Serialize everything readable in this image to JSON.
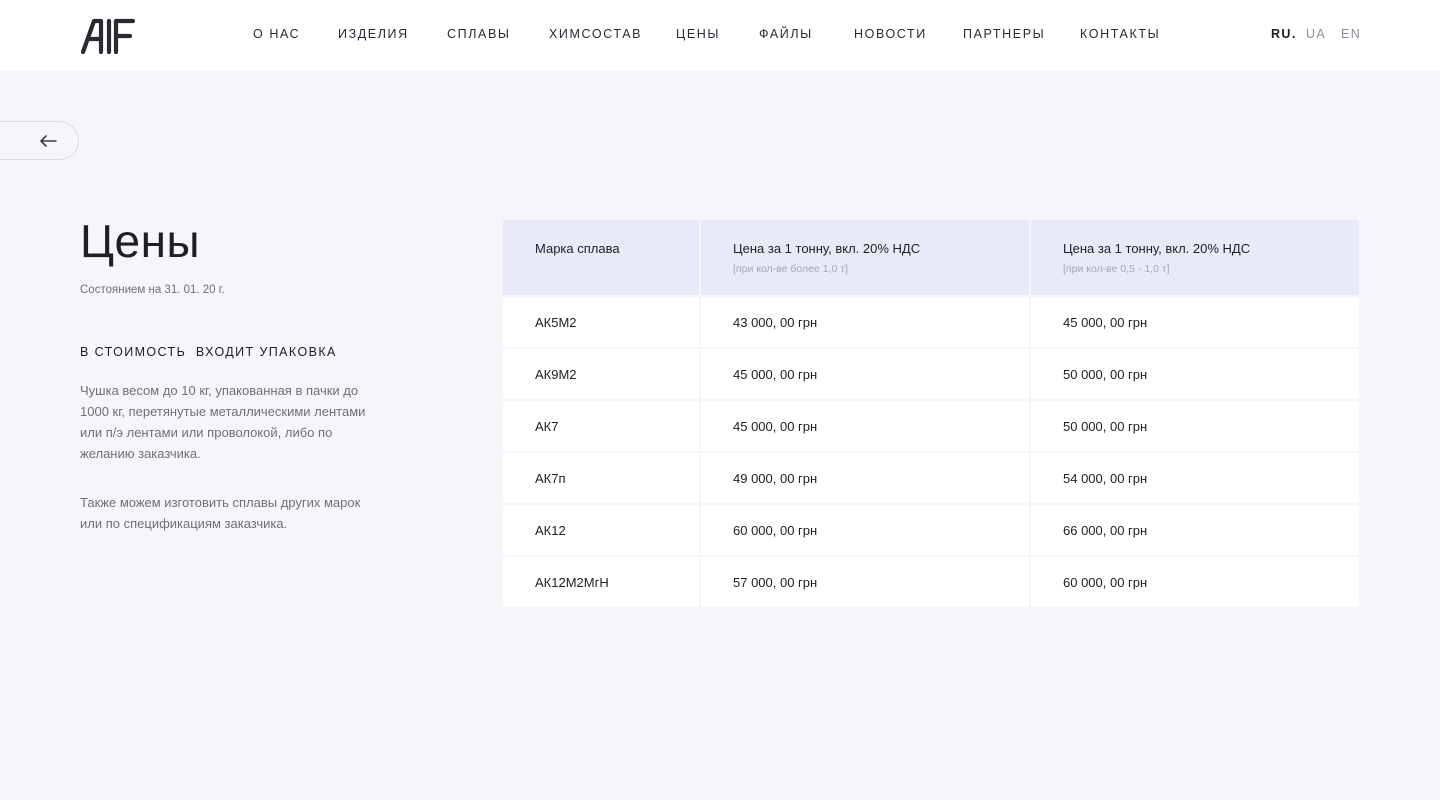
{
  "header": {
    "nav": [
      "О НАС",
      "ИЗДЕЛИЯ",
      "СПЛАВЫ",
      "ХИМСОСТАВ",
      "ЦЕНЫ",
      "ФАЙЛЫ",
      "НОВОСТИ",
      "ПАРТНЕРЫ",
      "КОНТАКТЫ"
    ],
    "languages": {
      "ru": "RU",
      "ua": "UA",
      "en": "EN"
    },
    "active_language": "RU"
  },
  "colors": {
    "background": "#f6f6fa",
    "table_header": "#e9eaf8",
    "text": "#1e1e24",
    "muted": "#6f6f7a"
  },
  "icons": {
    "back": "arrow-left-icon",
    "logo": "alf-logo"
  },
  "page": {
    "title": "Цены",
    "date_note": "Состоянием на 31. 01. 20 г.",
    "packaging_heading": "В СТОИМОСТЬ  ВХОДИТ УПАКОВКА",
    "paragraph_1": "Чушка весом до 10 кг, упакованная в пачки до 1000 кг, перетянутые металлическими лентами или п/э лентами или проволокой, либо по желанию заказчика.",
    "paragraph_2": "Также можем изготовить сплавы других марок или по спецификациям заказчика."
  },
  "table": {
    "headers": [
      {
        "label": "Марка сплава",
        "note": ""
      },
      {
        "label": "Цена за 1 тонну, вкл. 20% НДС",
        "note": "[при кол-ве более 1,0 т]"
      },
      {
        "label": "Цена за 1 тонну, вкл. 20% НДС",
        "note": "[при кол-ве 0,5 - 1,0 т]"
      }
    ],
    "rows": [
      [
        "АК5М2",
        "43 000, 00 грн",
        "45 000, 00 грн"
      ],
      [
        "АК9М2",
        "45 000, 00 грн",
        "50 000, 00 грн"
      ],
      [
        "АК7",
        "45 000, 00 грн",
        "50 000, 00 грн"
      ],
      [
        "АК7п",
        "49 000, 00 грн",
        "54 000, 00 грн"
      ],
      [
        "АК12",
        "60 000, 00 грн",
        "66 000, 00 грн"
      ],
      [
        "АК12М2МгН",
        "57 000, 00 грн",
        "60 000, 00 грн"
      ]
    ]
  }
}
